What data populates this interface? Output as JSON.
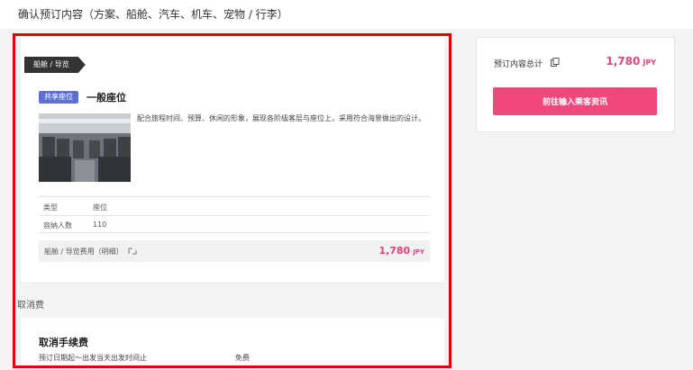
{
  "header": {
    "title": "确认预订内容（方案、船舱、汽车、机车、宠物 / 行李）"
  },
  "product": {
    "category_tag": "船舱 / 导览",
    "seat_badge": "共享座位",
    "seat_name": "一般座位",
    "image_icon": "ferry-seating-photo",
    "description": "配合旅程时间、预算、休闲的形象，展现各阶级客层与座位上，采用符合海景做出的设计。",
    "specs": [
      {
        "label": "类型",
        "value": "座位"
      },
      {
        "label": "容纳人数",
        "value": "110"
      }
    ],
    "fee_label": "船舱 / 导览费用（明细）",
    "fee_icon": "info-icon",
    "fee_amount": "1,780",
    "fee_currency": "JPY"
  },
  "cancellation": {
    "heading": "取消费",
    "title": "取消手续费",
    "rule": "预订日期起～出发当天出发时间止",
    "fee": "免费"
  },
  "summary": {
    "total_label": "预订内容总计",
    "copy_icon": "copy-icon",
    "total_amount": "1,780",
    "total_currency": "JPY",
    "proceed_label": "前往输入乘客资讯"
  },
  "colors": {
    "accent_pink": "#f0487c",
    "price_pink": "#e8417a",
    "badge_blue": "#5b6fd6",
    "highlight_red": "#e00000",
    "tag_dark": "#333333"
  }
}
